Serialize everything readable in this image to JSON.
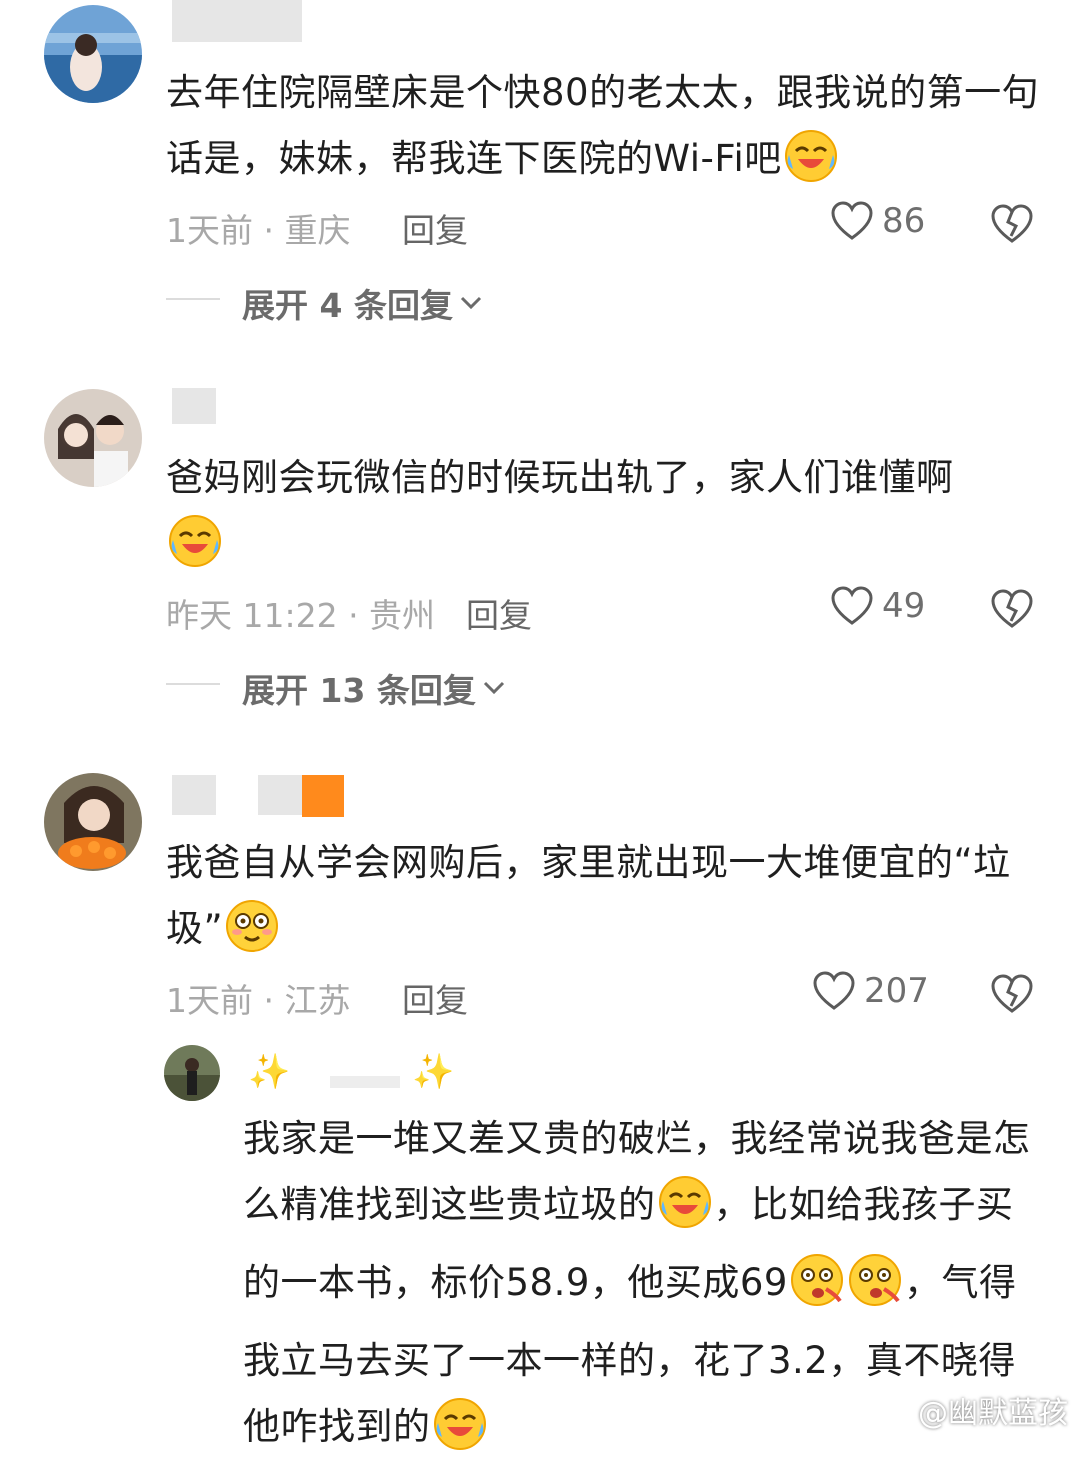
{
  "comments": [
    {
      "text": "去年住院隔壁床是个快80的老太太，跟我说的第一句话是，妹妹，帮我连下医院的Wi-Fi吧",
      "emoji": "laugh-cry-emoji",
      "meta": "1天前 · 重庆",
      "reply_label": "回复",
      "likes": "86",
      "expand": "展开 4 条回复"
    },
    {
      "text": "爸妈刚会玩微信的时候玩出轨了，家人们谁懂啊",
      "emoji": "laugh-cry-emoji",
      "meta": "昨天 11:22 · 贵州",
      "reply_label": "回复",
      "likes": "49",
      "expand": "展开 13 条回复"
    },
    {
      "text": "我爸自从学会网购后，家里就出现一大堆便宜的“垃圾”",
      "emoji": "dazed-emoji",
      "meta": "1天前 · 江苏",
      "reply_label": "回复",
      "likes": "207"
    }
  ],
  "reply": {
    "part1": "我家是一堆又差又贵的破烂，我经常说我爸是怎么精准找到这些贵垃圾的",
    "part2": "，比如给我孩子买的一本书，标价58.9，他买成69",
    "part3": "，气得我立马去买了一本一样的，花了3.2，真不晓得他咋找到的"
  },
  "watermark": "@幽默蓝孩",
  "colors": {
    "meta_gray": "#a8a8a8",
    "text": "#1f1f1f",
    "accent_orange": "#ff8a1c"
  }
}
